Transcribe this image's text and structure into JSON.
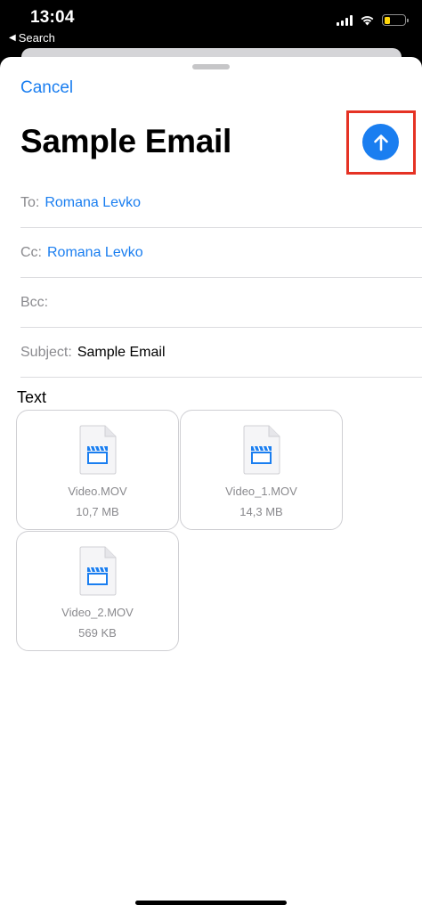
{
  "status_bar": {
    "time": "13:04",
    "back_label": "Search"
  },
  "compose": {
    "cancel_label": "Cancel",
    "title": "Sample Email",
    "to_label": "To:",
    "to_value": "Romana Levko",
    "cc_label": "Cc:",
    "cc_value": "Romana Levko",
    "bcc_label": "Bcc:",
    "subject_label": "Subject:",
    "subject_value": "Sample Email",
    "body": "Text"
  },
  "attachments": [
    {
      "name": "Video.MOV",
      "size": "10,7 MB"
    },
    {
      "name": "Video_1.MOV",
      "size": "14,3 MB"
    },
    {
      "name": "Video_2.MOV",
      "size": "569 KB"
    }
  ],
  "colors": {
    "accent": "#1a7ef0",
    "highlight": "#e53224",
    "battery": "#ffd60a"
  }
}
